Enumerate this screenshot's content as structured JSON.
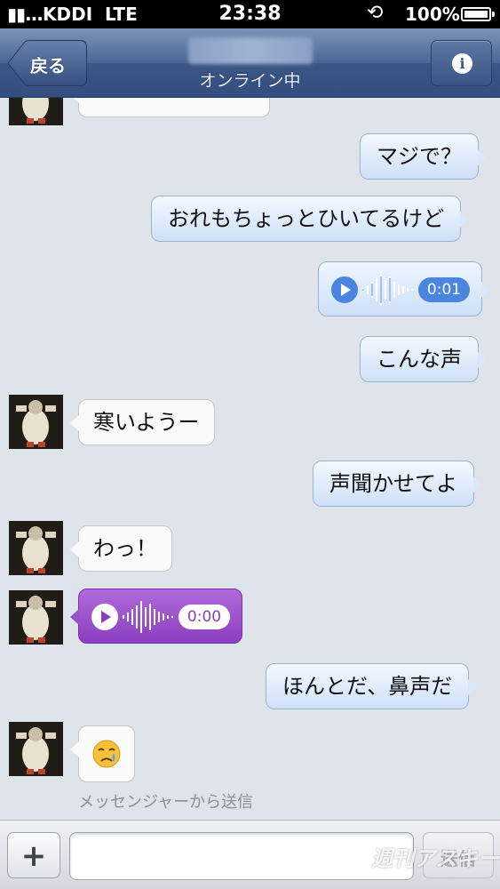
{
  "status_bar": {
    "signal": "▮▮...",
    "carrier": "KDDI",
    "network": "LTE",
    "time": "23:38",
    "rotation_lock_icon": "rotation-lock-icon",
    "battery_percent": "100%"
  },
  "nav": {
    "back_label": "戻る",
    "subtitle": "オンライン中",
    "info_icon": "info-icon"
  },
  "messages": [
    {
      "direction": "in",
      "type": "text",
      "text": ""
    },
    {
      "direction": "out",
      "type": "text",
      "text": "マジで？"
    },
    {
      "direction": "out",
      "type": "text",
      "text": "おれもちょっとひいてるけど"
    },
    {
      "direction": "out",
      "type": "voice",
      "duration": "0:01"
    },
    {
      "direction": "out",
      "type": "text",
      "text": "こんな声"
    },
    {
      "direction": "in",
      "type": "text",
      "text": "寒いようー"
    },
    {
      "direction": "out",
      "type": "text",
      "text": "声聞かせてよ"
    },
    {
      "direction": "in",
      "type": "text",
      "text": "わっ！"
    },
    {
      "direction": "in",
      "type": "voice",
      "duration": "0:00"
    },
    {
      "direction": "out",
      "type": "text",
      "text": "ほんとだ、鼻声だ"
    },
    {
      "direction": "in",
      "type": "emoji",
      "text": "😢"
    }
  ],
  "sent_via": "メッセンジャーから送信",
  "input_bar": {
    "plus_label": "+",
    "placeholder": "",
    "send_label": "送信"
  },
  "watermark": "週刊アスキー",
  "colors": {
    "nav_blue": "#3b5685",
    "out_bubble": "#cfe1f8",
    "in_voice_purple": "#8a3fc0",
    "out_voice_blue": "#4a86e0"
  }
}
